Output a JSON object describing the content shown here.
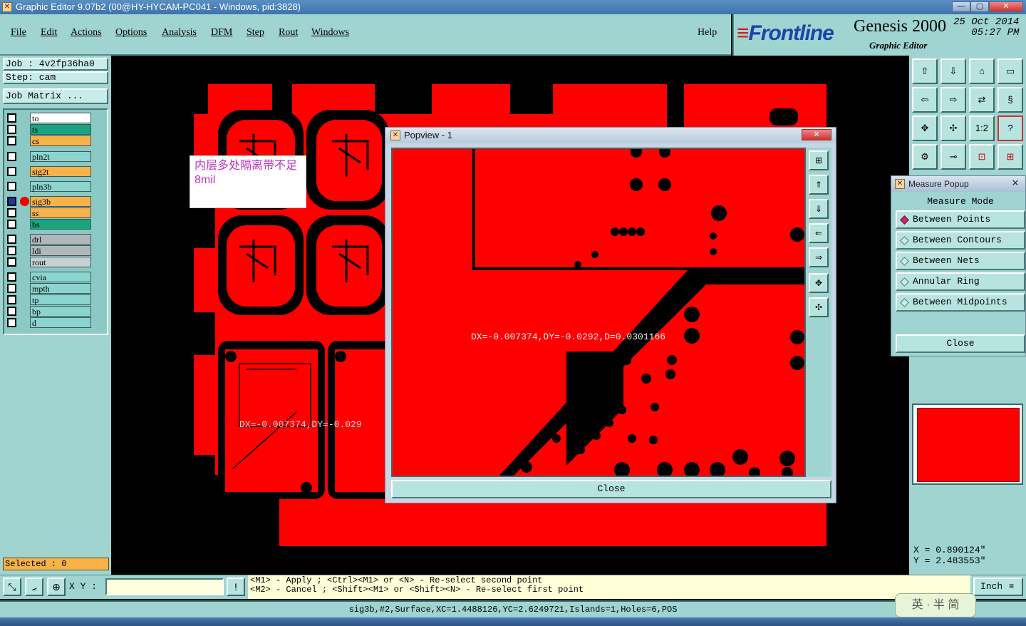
{
  "window": {
    "title": "Graphic Editor 9.07b2 (00@HY-HYCAM-PC041 - Windows, pid:3828)",
    "controls": [
      "—",
      "▢",
      "✕"
    ]
  },
  "menu": {
    "items": [
      "File",
      "Edit",
      "Actions",
      "Options",
      "Analysis",
      "DFM",
      "Step",
      "Rout",
      "Windows"
    ],
    "help": "Help"
  },
  "brand": {
    "logo_prefix": "Front",
    "logo_suffix": "line",
    "product": "Genesis 2000",
    "subtitle": "Graphic Editor",
    "date": "25 Oct 2014",
    "time": "05:27 PM"
  },
  "job": {
    "job_label": "Job  : 4v2fp36ha0",
    "step_label": "Step: cam",
    "matrix_button": "Job Matrix ..."
  },
  "layers": [
    {
      "name": "to",
      "color": "#ffffff"
    },
    {
      "name": "ts",
      "color": "#1aa37f"
    },
    {
      "name": "cs",
      "color": "#f7b24a"
    },
    {
      "name": "pln2t",
      "color": "#8cd4d0"
    },
    {
      "name": "sig2t",
      "color": "#f7b24a"
    },
    {
      "name": "pln3b",
      "color": "#8cd4d0"
    },
    {
      "name": "sig3b",
      "color": "#f7b24a"
    },
    {
      "name": "ss",
      "color": "#f7b24a"
    },
    {
      "name": "bs",
      "color": "#1aa37f"
    },
    {
      "name": "drl",
      "color": "#b0b8bc"
    },
    {
      "name": "ldi",
      "color": "#b0b8bc"
    },
    {
      "name": "rout",
      "color": "#c8d0d4"
    },
    {
      "name": "cvia",
      "color": "#8cd4d0"
    },
    {
      "name": "mpth",
      "color": "#8cd4d0"
    },
    {
      "name": "tp",
      "color": "#8cd4d0"
    },
    {
      "name": "bp",
      "color": "#8cd4d0"
    },
    {
      "name": "d",
      "color": "#8cd4d0"
    }
  ],
  "selected": "Selected : 0",
  "annotation": "内层多处隔离带不足8mil",
  "canvas_measure_text": "DX=-0.007374,DY=-0.029",
  "popview": {
    "title": "Popview - 1",
    "measure_text": "DX=-0.007374,DY=-0.0292,D=0.0301166",
    "close": "Close"
  },
  "measure_popup": {
    "title": "Measure Popup",
    "header": "Measure Mode",
    "modes": [
      {
        "label": "Between Points",
        "selected": true
      },
      {
        "label": "Between Contours",
        "selected": false
      },
      {
        "label": "Between Nets",
        "selected": false
      },
      {
        "label": "Annular Ring",
        "selected": false
      },
      {
        "label": "Between Midpoints",
        "selected": false
      }
    ],
    "close": "Close"
  },
  "tools": {
    "rows": [
      [
        "home-icon",
        "fit-icon",
        "zoom-home-icon",
        "zoom-area-icon"
      ],
      [
        "pan-left-icon",
        "pan-right-icon",
        "swap-icon",
        "s-curve-icon"
      ],
      [
        "zoom-fit-icon",
        "zoom-center-icon",
        "scale-1-2-icon",
        "help-icon"
      ],
      [
        "snap-icon",
        "measure-icon",
        "drc-icon",
        "net-icon"
      ]
    ],
    "scale_label": "1:2",
    "help_label": "?"
  },
  "coords": {
    "x": "X = 0.890124\"",
    "y": "Y = 2.483553\""
  },
  "bottom": {
    "xy_label": "X Y :",
    "xy_value": "",
    "hint1": "<M1> - Apply  ; <Ctrl><M1> or <N> - Re-select second point",
    "hint2": "<M2> - Cancel ; <Shift><M1> or <Shift><N> - Re-select first point",
    "unit": "Inch",
    "status": "sig3b,#2,Surface,XC=1.4488126,YC=2.6249721,Islands=1,Holes=6,POS",
    "ime": "英 · 半 简"
  }
}
